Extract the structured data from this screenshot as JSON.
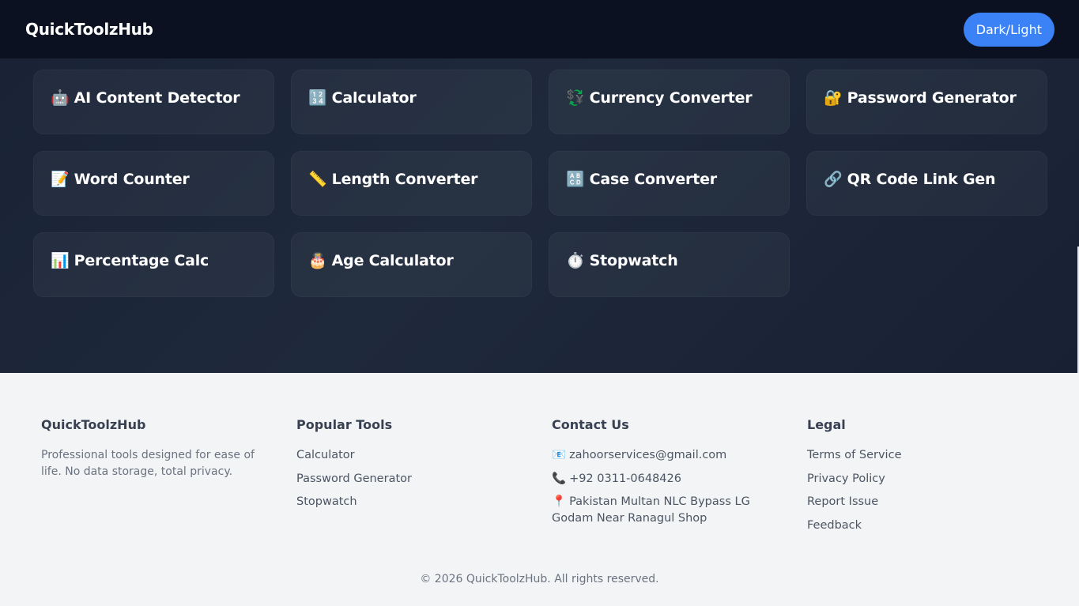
{
  "header": {
    "brand": "QuickToolzHub",
    "theme_toggle_label": "Dark/Light"
  },
  "tools": [
    {
      "icon": "🤖",
      "icon_name": "robot-icon",
      "label": "AI Content Detector"
    },
    {
      "icon": "🔢",
      "icon_name": "numbers-icon",
      "label": "Calculator"
    },
    {
      "icon": "💱",
      "icon_name": "currency-exchange-icon",
      "label": "Currency Converter"
    },
    {
      "icon": "🔐",
      "icon_name": "lock-key-icon",
      "label": "Password Generator"
    },
    {
      "icon": "📝",
      "icon_name": "memo-icon",
      "label": "Word Counter"
    },
    {
      "icon": "📏",
      "icon_name": "ruler-icon",
      "label": "Length Converter"
    },
    {
      "icon": "🔠",
      "icon_name": "uppercase-letters-icon",
      "label": "Case Converter"
    },
    {
      "icon": "🔗",
      "icon_name": "link-icon",
      "label": "QR Code Link Gen"
    },
    {
      "icon": "📊",
      "icon_name": "bar-chart-icon",
      "label": "Percentage Calc"
    },
    {
      "icon": "🎂",
      "icon_name": "birthday-cake-icon",
      "label": "Age Calculator"
    },
    {
      "icon": "⏱️",
      "icon_name": "stopwatch-icon",
      "label": "Stopwatch"
    }
  ],
  "footer": {
    "about": {
      "title": "QuickToolzHub",
      "description": "Professional tools designed for ease of life. No data storage, total privacy."
    },
    "popular": {
      "title": "Popular Tools",
      "links": [
        "Calculator",
        "Password Generator",
        "Stopwatch"
      ]
    },
    "contact": {
      "title": "Contact Us",
      "email_icon": "📧",
      "email": "zahoorservices@gmail.com",
      "phone_icon": "📞",
      "phone": "+92 0311-0648426",
      "address_icon": "📍",
      "address": "Pakistan Multan NLC Bypass LG Godam Near Ranagul Shop"
    },
    "legal": {
      "title": "Legal",
      "links": [
        "Terms of Service",
        "Privacy Policy",
        "Report Issue",
        "Feedback"
      ]
    },
    "copyright": "© 2026 QuickToolzHub. All rights reserved."
  },
  "colors": {
    "accent": "#3b82f6",
    "header_bg": "#0b1120",
    "hero_bg": "#1e293b",
    "footer_bg": "#f3f4f6"
  }
}
